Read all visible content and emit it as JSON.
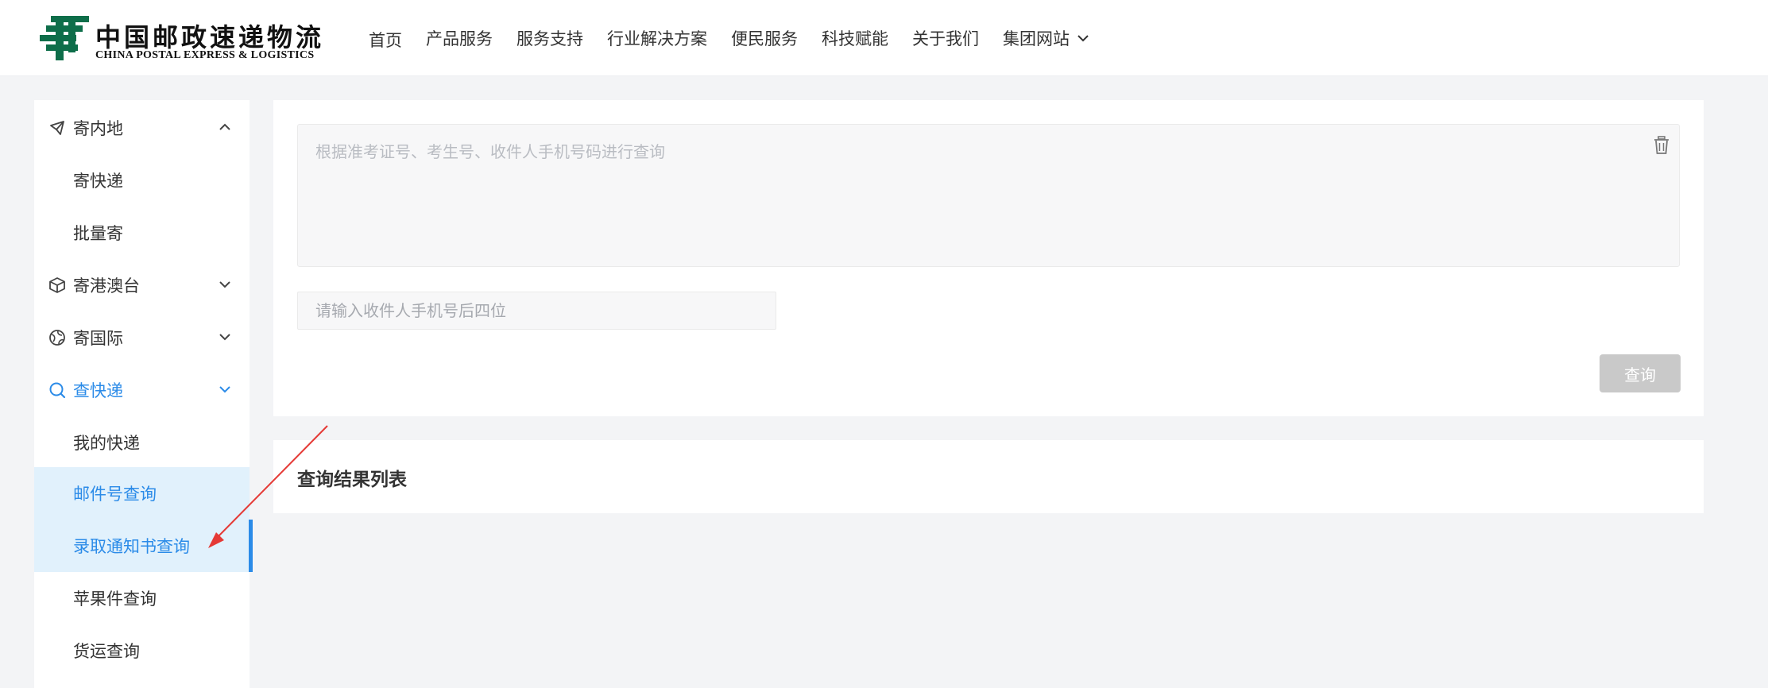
{
  "header": {
    "logo_cn": "中国邮政速递物流",
    "logo_en": "CHINA POSTAL EXPRESS & LOGISTICS",
    "brand_color": "#0e6e4a",
    "nav": [
      {
        "label": "首页"
      },
      {
        "label": "产品服务"
      },
      {
        "label": "服务支持"
      },
      {
        "label": "行业解决方案"
      },
      {
        "label": "便民服务"
      },
      {
        "label": "科技赋能"
      },
      {
        "label": "关于我们"
      },
      {
        "label": "集团网站",
        "has_dropdown": true,
        "icon": "chevron-down-icon"
      }
    ]
  },
  "sidebar": {
    "accent_color": "#2b8be8",
    "highlight_bg": "#e1f1fc",
    "groups": [
      {
        "label": "寄内地",
        "icon": "send-plane-icon",
        "expanded": true,
        "items": [
          {
            "label": "寄快递"
          },
          {
            "label": "批量寄"
          }
        ]
      },
      {
        "label": "寄港澳台",
        "icon": "box-icon",
        "expanded": false
      },
      {
        "label": "寄国际",
        "icon": "globe-icon",
        "expanded": false
      },
      {
        "label": "查快递",
        "icon": "search-icon",
        "expanded": true,
        "active": true,
        "items": [
          {
            "label": "我的快递"
          },
          {
            "label": "邮件号查询",
            "highlighted": true
          },
          {
            "label": "录取通知书查询",
            "highlighted": true,
            "selected": true
          },
          {
            "label": "苹果件查询"
          },
          {
            "label": "货运查询"
          }
        ]
      }
    ]
  },
  "query": {
    "textarea_placeholder": "根据准考证号、考生号、收件人手机号码进行查询",
    "textarea_value": "",
    "phone_placeholder": "请输入收件人手机号后四位",
    "phone_value": "",
    "submit_label": "查询",
    "submit_color": "#c9c9c9",
    "clear_icon": "trash-icon"
  },
  "results": {
    "title": "查询结果列表"
  },
  "annotation": {
    "arrow_color": "#e53935"
  }
}
